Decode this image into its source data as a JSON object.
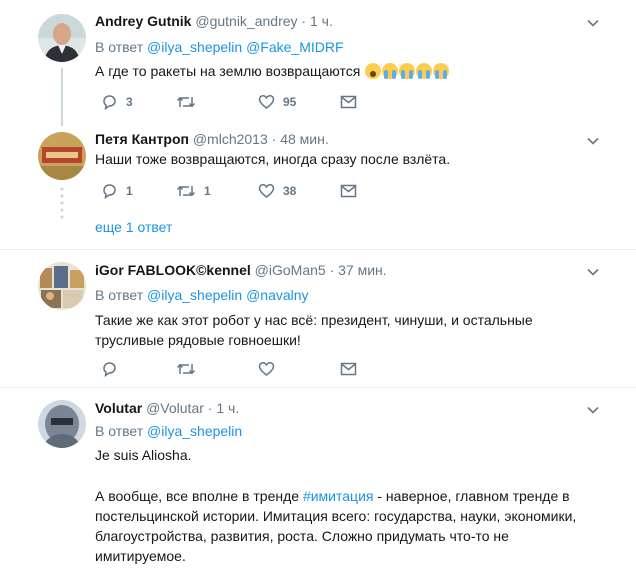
{
  "tweets": [
    {
      "name": "Andrey Gutnik",
      "handle": "@gutnik_andrey",
      "time": "· 1 ч.",
      "reply_prefix": "В ответ",
      "mentions": [
        "@ilya_shepelin",
        "@Fake_MIDRF"
      ],
      "text": "А где то ракеты на землю возвращаются",
      "emojis": [
        "face-screaming-in-fear-emoji",
        "loudly-crying-face-emoji",
        "loudly-crying-face-emoji",
        "loudly-crying-face-emoji",
        "loudly-crying-face-emoji"
      ],
      "replies": "3",
      "retweets": "",
      "likes": "95"
    },
    {
      "name": "Петя Кантроп",
      "handle": "@mlch2013",
      "time": "· 48 мин.",
      "text": "Наши тоже возвращаются, иногда сразу после взлёта.",
      "replies": "1",
      "retweets": "1",
      "likes": "38"
    },
    {
      "more_replies": "еще 1 ответ"
    },
    {
      "name": "iGor FABLOOK©kennel",
      "handle": "@iGoMan5",
      "time": "· 37 мин.",
      "reply_prefix": "В ответ",
      "mentions": [
        "@ilya_shepelin",
        "@navalny"
      ],
      "text_lines": [
        "Такие же как этот робот у нас всё: президент, чинуши, и остальные",
        "трусливые рядовые говноешки!"
      ],
      "replies": "",
      "retweets": "",
      "likes": ""
    },
    {
      "name": "Volutar",
      "handle": "@Volutar",
      "time": "· 1 ч.",
      "reply_prefix": "В ответ",
      "mentions": [
        "@ilya_shepelin"
      ],
      "para1": "Je suis Aliosha.",
      "para2_before": "А вообще, все вполне в тренде ",
      "para2_hashtag": "#имитация",
      "para2_line1_after": " - наверное, главном тренде в",
      "para2_lines": [
        "постельцинской истории. Имитация всего: государства, науки, экономики,",
        "благоустройства, развития, роста. Сложно придумать что-то не",
        "имитируемое."
      ]
    }
  ],
  "colors": {
    "accent": "#1b95e0",
    "muted": "#657786",
    "line": "#ccd6dd",
    "separator": "#e6ecf0"
  }
}
